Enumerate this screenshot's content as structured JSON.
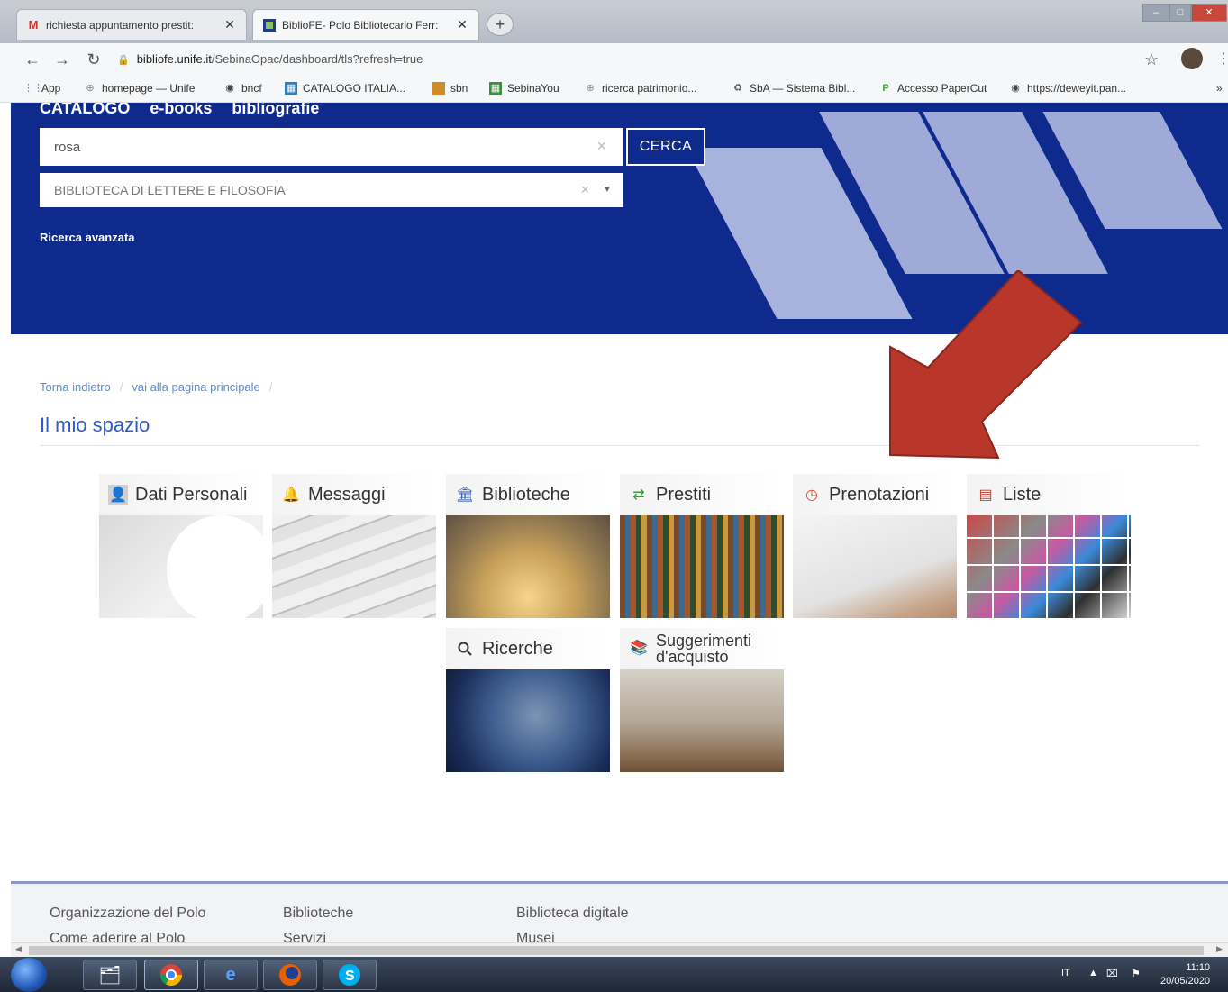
{
  "browser": {
    "tabs": [
      {
        "favicon": "gmail-icon",
        "title": "richiesta appuntamento prestit:",
        "active": false
      },
      {
        "favicon": "bibliofe-icon",
        "title": "BiblioFE- Polo Bibliotecario Ferr:",
        "active": true
      }
    ],
    "new_tab": "+",
    "url_host": "bibliofe.unife.it",
    "url_path": "/SebinaOpac/dashboard/tls?refresh=true",
    "bookmarks": [
      {
        "icon": "apps-icon",
        "label": "App"
      },
      {
        "icon": "globe-icon",
        "label": "homepage — Unife"
      },
      {
        "icon": "globe-icon",
        "label": "bncf"
      },
      {
        "icon": "catalog-icon",
        "label": "CATALOGO ITALIA..."
      },
      {
        "icon": "folder-icon",
        "label": "sbn"
      },
      {
        "icon": "catalog-icon",
        "label": "SebinaYou"
      },
      {
        "icon": "globe-icon",
        "label": "ricerca patrimonio..."
      },
      {
        "icon": "recycle-icon",
        "label": "SbA — Sistema Bibl..."
      },
      {
        "icon": "papercut-icon",
        "label": "Accesso PaperCut"
      },
      {
        "icon": "globe-icon",
        "label": "https://deweyit.pan..."
      }
    ]
  },
  "hero": {
    "nav": [
      "CATALOGO",
      "e-books",
      "bibliografie"
    ],
    "search_value": "rosa",
    "search_button": "CERCA",
    "library_select": "BIBLIOTECA DI LETTERE E FILOSOFIA",
    "advanced_search": "Ricerca avanzata"
  },
  "breadcrumb": {
    "back": "Torna indietro",
    "home": "vai alla pagina principale"
  },
  "page_title": "Il mio spazio",
  "tiles": [
    {
      "label": "Dati Personali",
      "icon": "user-icon"
    },
    {
      "label": "Messaggi",
      "icon": "bell-icon"
    },
    {
      "label": "Biblioteche",
      "icon": "library-icon"
    },
    {
      "label": "Prestiti",
      "icon": "swap-icon"
    },
    {
      "label": "Prenotazioni",
      "icon": "clock-icon"
    },
    {
      "label": "Liste",
      "icon": "list-icon"
    },
    {
      "label": "Ricerche",
      "icon": "search-icon"
    },
    {
      "label": "Suggerimenti d'acquisto",
      "icon": "books-icon"
    }
  ],
  "footer": {
    "col1": [
      "Organizzazione del Polo",
      "Come aderire al Polo"
    ],
    "col2": [
      "Biblioteche",
      "Servizi"
    ],
    "col3": [
      "Biblioteca digitale",
      "Musei"
    ]
  },
  "taskbar": {
    "lang": "IT",
    "time": "11:10",
    "date": "20/05/2020"
  },
  "colors": {
    "hero_bg": "#0e2a8c",
    "accent_link": "#2e5cc2",
    "arrow": "#b8362a"
  }
}
